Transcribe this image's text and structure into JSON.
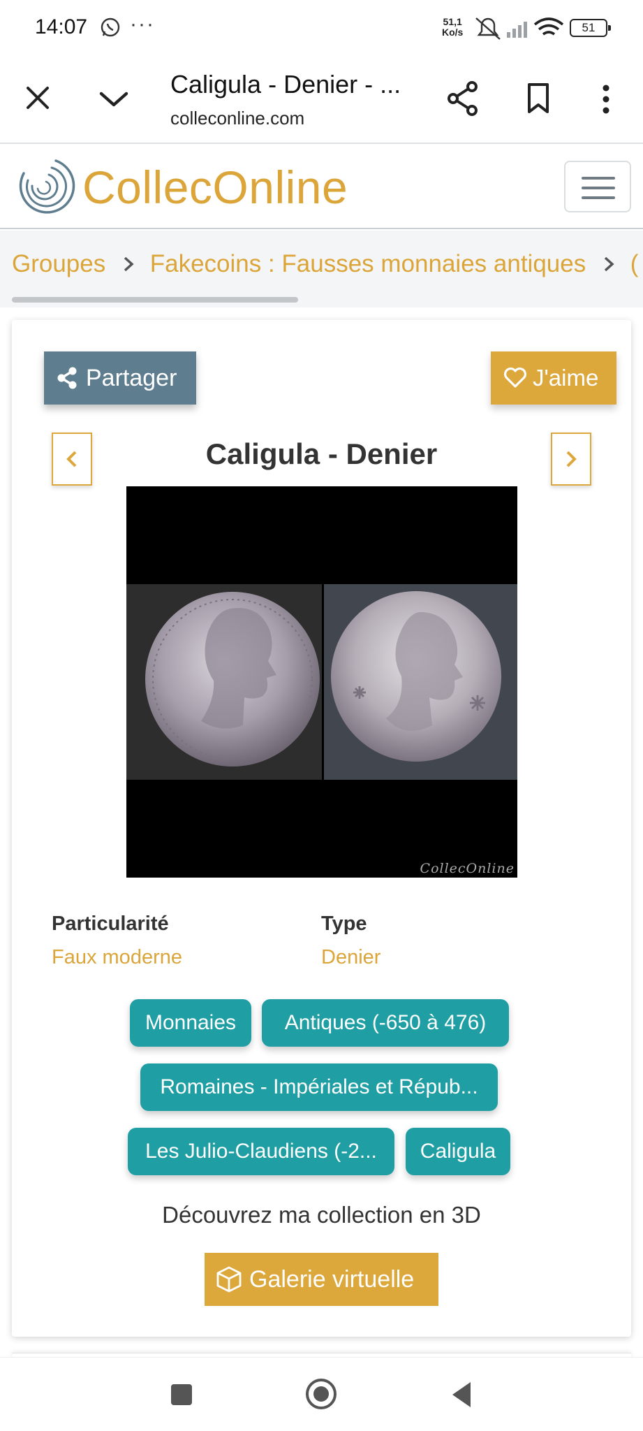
{
  "status_bar": {
    "time": "14:07",
    "more": "···",
    "speed_value": "51,1",
    "speed_unit": "Ko/s",
    "battery": "51"
  },
  "browser": {
    "title": "Caligula - Denier - ...",
    "url": "colleconline.com"
  },
  "site": {
    "logo_text": "CollecOnline"
  },
  "breadcrumb": {
    "items": [
      "Groupes",
      "Fakecoins : Fausses monnaies antiques",
      "("
    ]
  },
  "item": {
    "share_label": "Partager",
    "like_label": "J'aime",
    "title": "Caligula - Denier",
    "watermark": "CollecOnline",
    "attributes": [
      {
        "label": "Particularité",
        "value": "Faux moderne"
      },
      {
        "label": "Type",
        "value": "Denier"
      }
    ],
    "tags": [
      "Monnaies",
      "Antiques (-650 à 476)",
      "Romaines - Impériales et Répub...",
      "Les Julio-Claudiens (-2...",
      "Caligula"
    ],
    "discover_text": "Découvrez ma collection en 3D",
    "gallery_label": "Galerie virtuelle"
  },
  "colors": {
    "accent_gold": "#dca73b",
    "tag_teal": "#1f9ea4",
    "share_slate": "#5e7d8f"
  }
}
